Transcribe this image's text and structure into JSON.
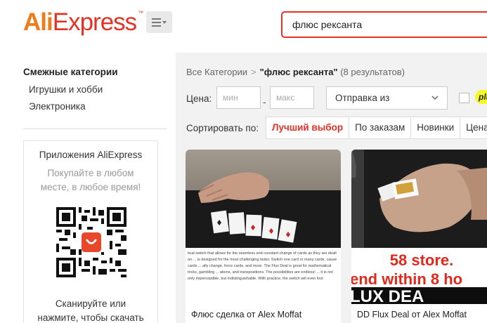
{
  "header": {
    "logo_ali": "Ali",
    "logo_express": "Express",
    "logo_tm": "™",
    "menu_icon": "hamburger-dropdown-icon",
    "search_value": "флюс рексанта"
  },
  "sidebar": {
    "title": "Смежные категории",
    "links": [
      "Игрушки и хобби",
      "Электроника"
    ],
    "app": {
      "title": "Приложения AliExpress",
      "subtitle_line1": "Покупайте в любом",
      "subtitle_line2": "месте, в любое время!",
      "scan_line1": "Сканируйте или",
      "scan_line2": "нажмите, чтобы скачать"
    }
  },
  "main": {
    "breadcrumb": {
      "root": "Все Категории",
      "separator": ">",
      "query": "\"флюс рексанта\"",
      "count": "(8 результатов)"
    },
    "filters": {
      "price_label": "Цена:",
      "min_placeholder": "мин",
      "max_placeholder": "макс",
      "dash": "-",
      "ship_from": "Отправка из",
      "plus_label": "plus"
    },
    "sort": {
      "label": "Сортировать по:",
      "options": [
        "Лучший выбор",
        "По заказам",
        "Новинки",
        "Цена"
      ],
      "active_index": 0
    },
    "products": [
      {
        "title": "Флюс сделка от Alex Moffat",
        "caption_text": "tical switch that allows for the seamless and constant change of cards as they are dealt on ... is designed for the most challenging tasks: Switch one card or many cards, cause cards ... ally change, force cards, and more. The Flux Deal is great for mathematical tricks, gambling ... ations, and transpositions. The possibilities are endless! ... it is not only imperceptible, but indistinguishable. With practice, the switch will even fool"
      },
      {
        "title": "DD Flux Deal от Alex Moffat",
        "overlay_line1": "58 store.",
        "overlay_line2": "end within 8 ho",
        "overlay_line3": "LUX DEA"
      }
    ]
  },
  "colors": {
    "brand_orange": "#f07b1d",
    "brand_red": "#e43225",
    "plus_yellow": "#f3fb2a"
  }
}
